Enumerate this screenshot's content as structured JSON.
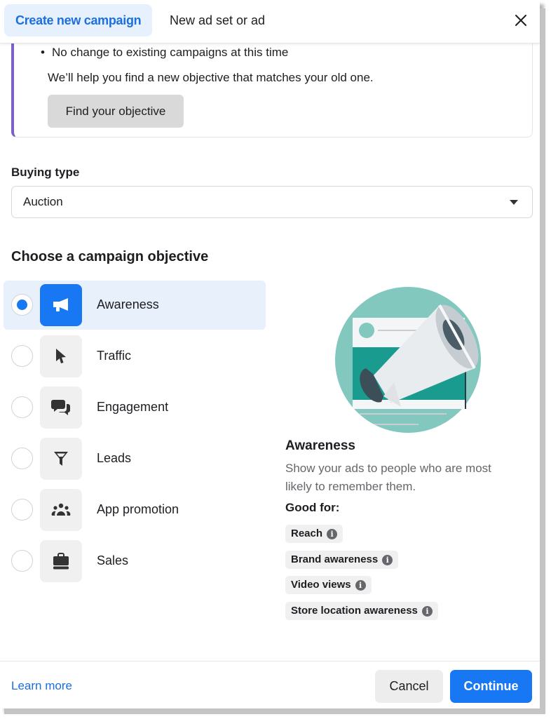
{
  "header": {
    "tabs": [
      {
        "label": "Create new campaign",
        "active": true
      },
      {
        "label": "New ad set or ad",
        "active": false
      }
    ],
    "close_icon": "close-icon"
  },
  "info_card": {
    "bullet": "No change to existing campaigns at this time",
    "text": "We’ll help you find a new objective that matches your old one.",
    "button_label": "Find your objective",
    "accent_color": "#7b61c7"
  },
  "buying_type": {
    "label": "Buying type",
    "selected": "Auction"
  },
  "objectives": {
    "heading": "Choose a campaign objective",
    "selected_index": 0,
    "items": [
      {
        "label": "Awareness",
        "icon": "megaphone-icon"
      },
      {
        "label": "Traffic",
        "icon": "cursor-icon"
      },
      {
        "label": "Engagement",
        "icon": "chat-bubbles-icon"
      },
      {
        "label": "Leads",
        "icon": "funnel-icon"
      },
      {
        "label": "App promotion",
        "icon": "people-group-icon"
      },
      {
        "label": "Sales",
        "icon": "shopping-bag-icon"
      }
    ]
  },
  "detail": {
    "title": "Awareness",
    "description": "Show your ads to people who are most likely to remember them.",
    "good_for_label": "Good for:",
    "tags": [
      "Reach",
      "Brand awareness",
      "Video views",
      "Store location awareness"
    ],
    "illustration": "megaphone-illustration"
  },
  "footer": {
    "learn_more": "Learn more",
    "cancel": "Cancel",
    "continue": "Continue"
  },
  "colors": {
    "primary": "#1877f2",
    "link": "#1b6fe0",
    "selected_bg": "#e8f0fc"
  }
}
